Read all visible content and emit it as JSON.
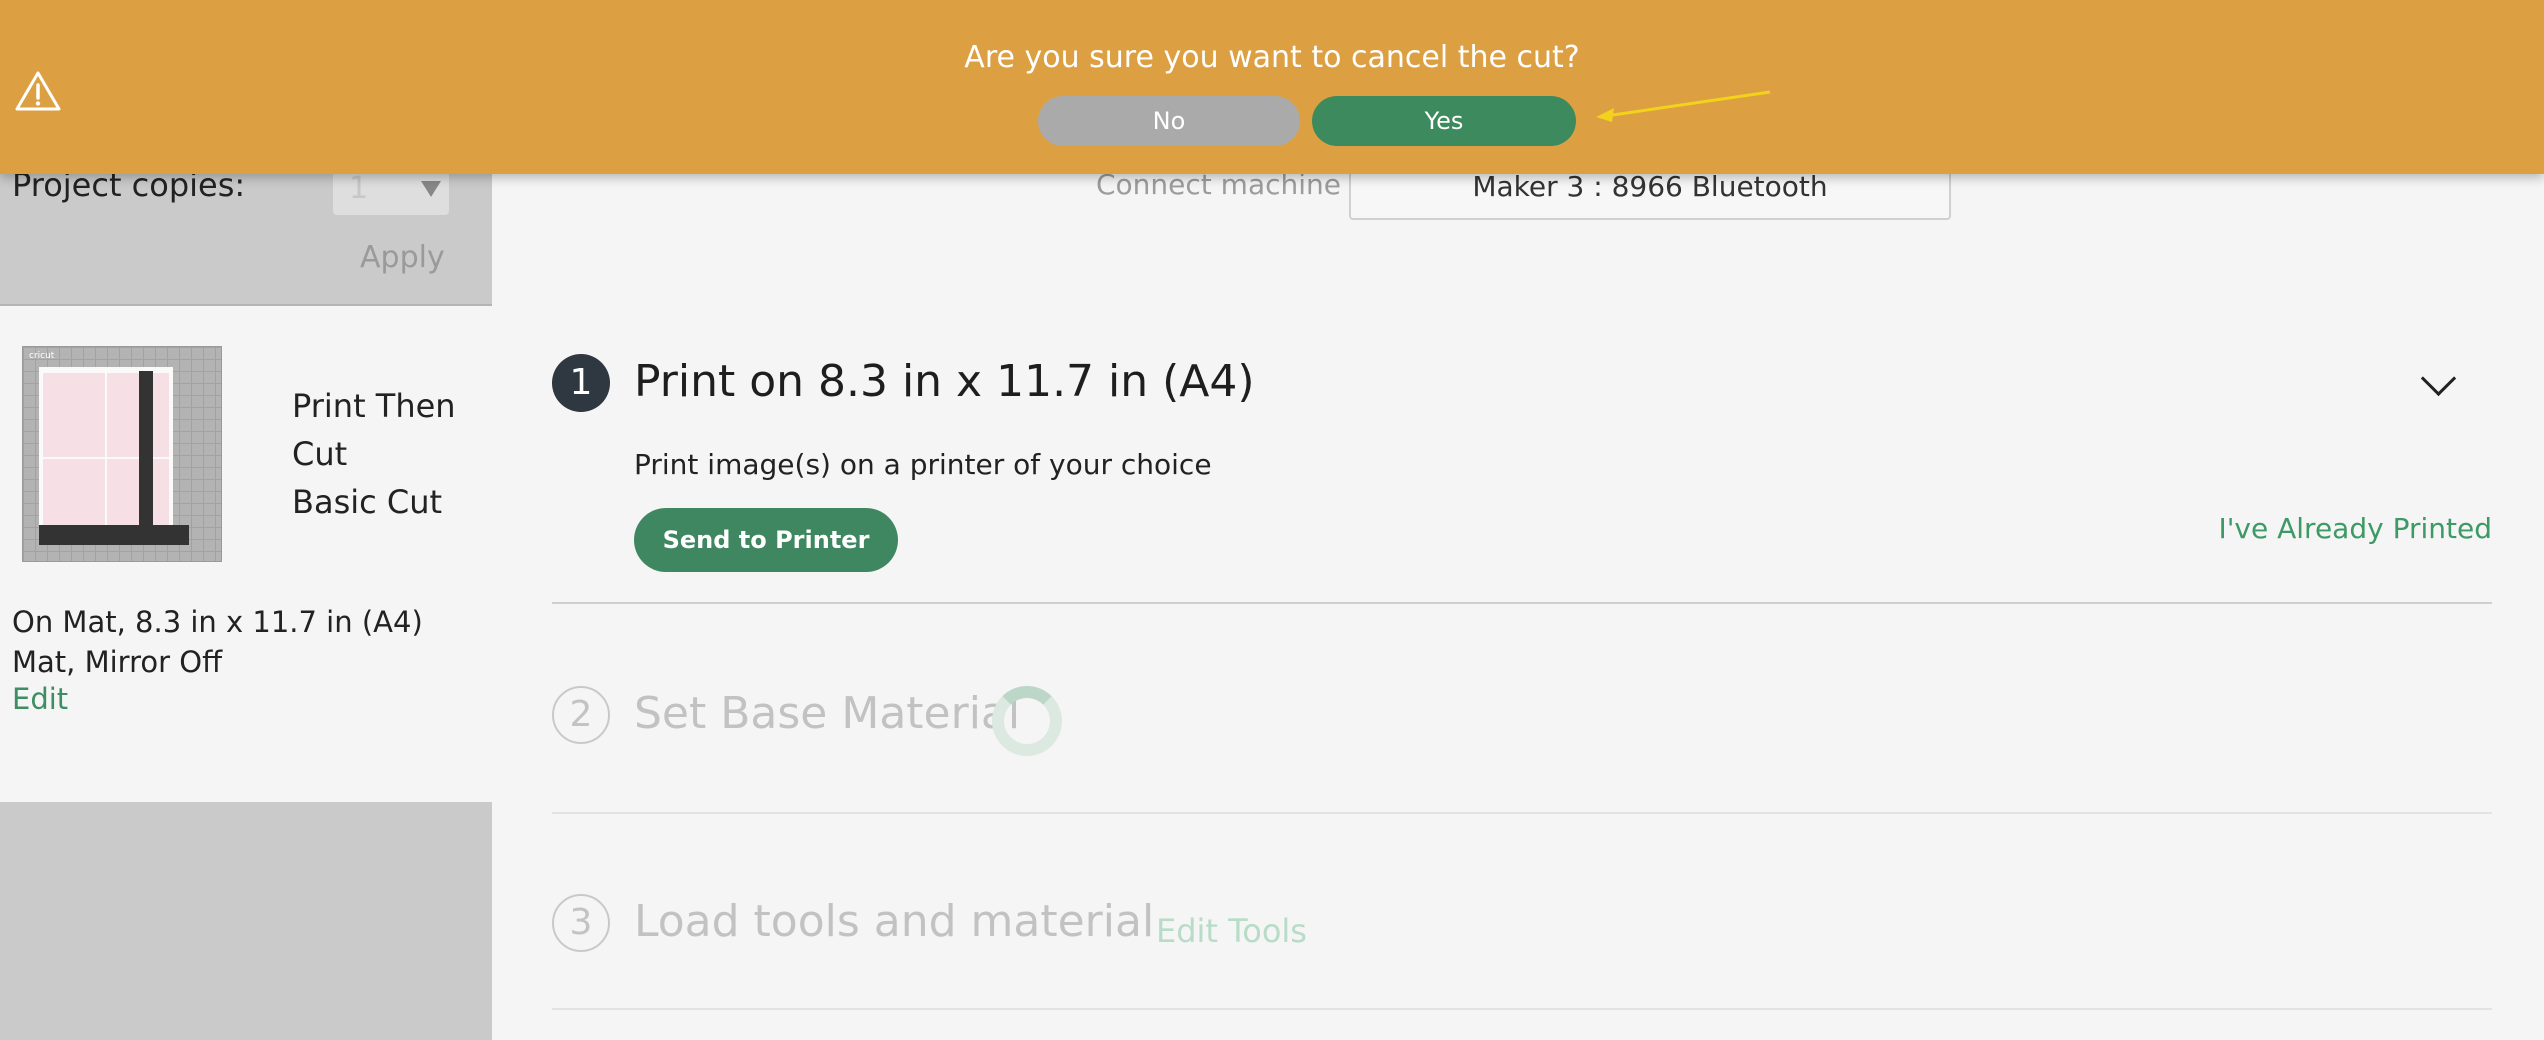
{
  "banner": {
    "question": "Are you sure you want to cancel the cut?",
    "no_label": "No",
    "yes_label": "Yes",
    "icon": "warning-icon",
    "color": "#dca043"
  },
  "sidebar": {
    "copies_label": "Project copies:",
    "copies_value": "1",
    "apply_label": "Apply",
    "mat": {
      "logo": "cricut",
      "labels": [
        "Print Then",
        "Cut",
        "Basic Cut"
      ],
      "info": "On Mat, 8.3 in x 11.7 in (A4) Mat, Mirror Off",
      "edit_label": "Edit"
    }
  },
  "machine": {
    "connect_label": "Connect machine",
    "name": "Maker 3 : 8966 Bluetooth"
  },
  "steps": [
    {
      "number": "1",
      "title": "Print on 8.3 in x 11.7 in (A4)",
      "subtitle": "Print image(s) on a printer of your choice",
      "primary_action": "Send to Printer",
      "secondary_action": "I've Already Printed"
    },
    {
      "number": "2",
      "title": "Set Base Material"
    },
    {
      "number": "3",
      "title": "Load tools and material",
      "action": "Edit Tools"
    }
  ],
  "colors": {
    "accent_green": "#3d8a5e",
    "sidebar_bg": "#cacaca",
    "annotation_arrow": "#f2d21b"
  }
}
